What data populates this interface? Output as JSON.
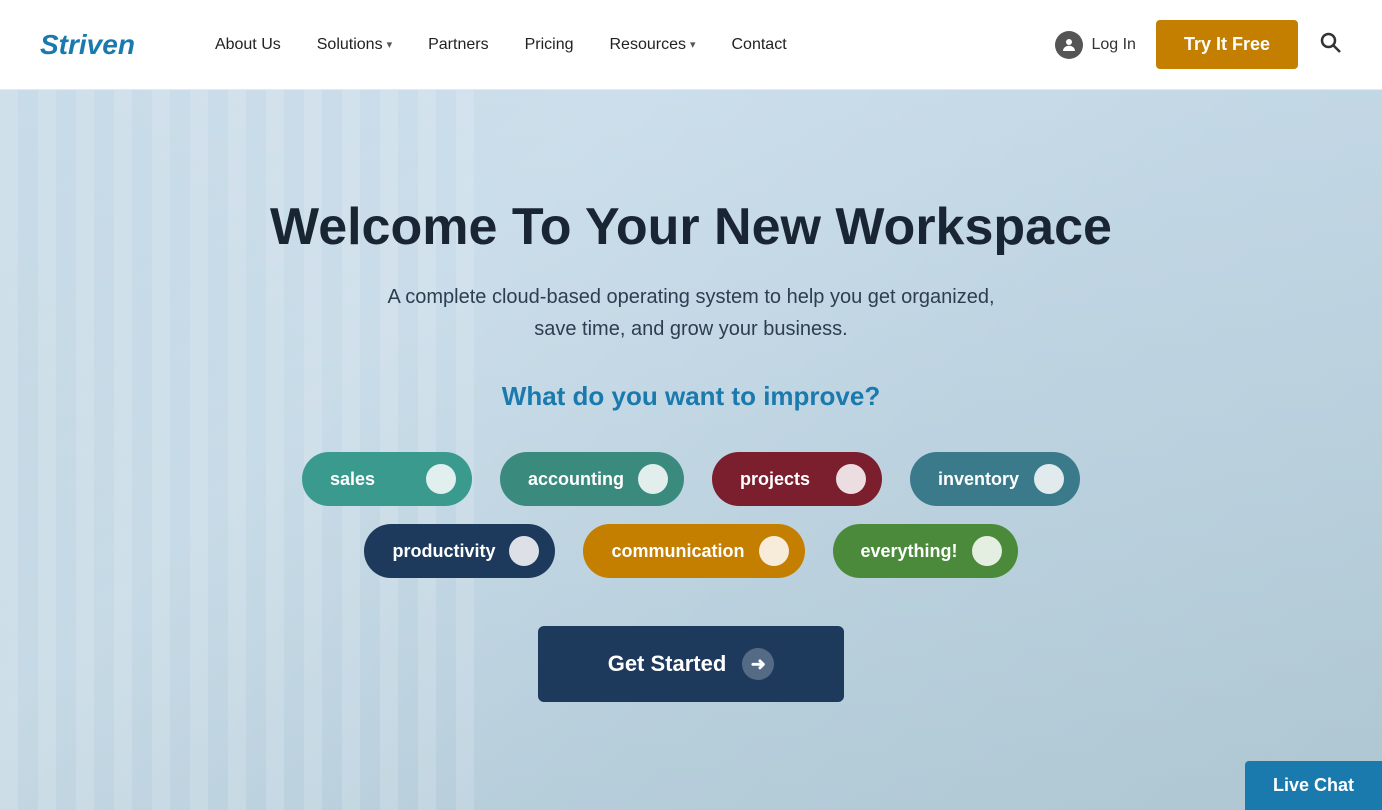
{
  "navbar": {
    "logo": "Striven",
    "links": [
      {
        "id": "about-us",
        "label": "About Us",
        "hasDropdown": false
      },
      {
        "id": "solutions",
        "label": "Solutions",
        "hasDropdown": true
      },
      {
        "id": "partners",
        "label": "Partners",
        "hasDropdown": false
      },
      {
        "id": "pricing",
        "label": "Pricing",
        "hasDropdown": false
      },
      {
        "id": "resources",
        "label": "Resources",
        "hasDropdown": true
      },
      {
        "id": "contact",
        "label": "Contact",
        "hasDropdown": false
      }
    ],
    "login_label": "Log In",
    "try_free_label": "Try It Free"
  },
  "hero": {
    "title": "Welcome To Your New Workspace",
    "subtitle": "A complete cloud-based operating system to help you get organized,\nsave time, and grow your business.",
    "question": "What do you want to improve?",
    "pills": [
      {
        "id": "sales",
        "label": "sales",
        "class": "pill-sales"
      },
      {
        "id": "accounting",
        "label": "accounting",
        "class": "pill-accounting"
      },
      {
        "id": "projects",
        "label": "projects",
        "class": "pill-projects"
      },
      {
        "id": "inventory",
        "label": "inventory",
        "class": "pill-inventory"
      },
      {
        "id": "productivity",
        "label": "productivity",
        "class": "pill-productivity"
      },
      {
        "id": "communication",
        "label": "communication",
        "class": "pill-communication"
      },
      {
        "id": "everything",
        "label": "everything!",
        "class": "pill-everything"
      }
    ],
    "cta_label": "Get Started"
  },
  "live_chat": {
    "label": "Live Chat"
  }
}
